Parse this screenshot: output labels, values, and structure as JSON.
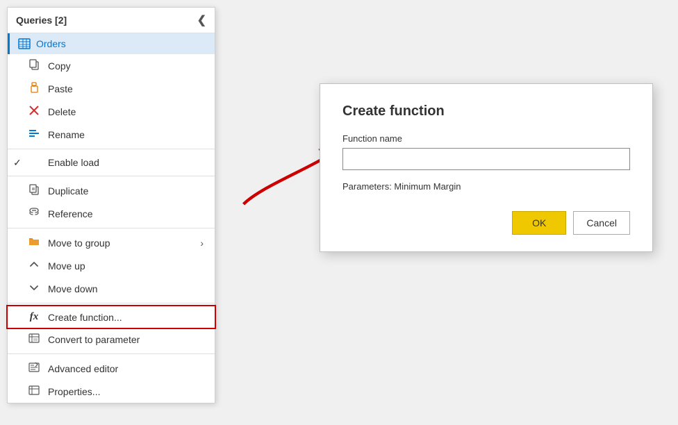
{
  "panel": {
    "title": "Queries [2]",
    "collapse_icon": "❮",
    "selected_query": "Orders"
  },
  "menu_items": [
    {
      "id": "copy",
      "label": "Copy",
      "icon": "copy",
      "indent": true
    },
    {
      "id": "paste",
      "label": "Paste",
      "icon": "paste",
      "indent": true
    },
    {
      "id": "delete",
      "label": "Delete",
      "icon": "delete",
      "indent": true
    },
    {
      "id": "rename",
      "label": "Rename",
      "icon": "rename",
      "indent": true
    },
    {
      "id": "divider1"
    },
    {
      "id": "enable-load",
      "label": "Enable load",
      "icon": "check",
      "indent": true,
      "checkmark": "✓"
    },
    {
      "id": "divider2"
    },
    {
      "id": "duplicate",
      "label": "Duplicate",
      "icon": "duplicate",
      "indent": true
    },
    {
      "id": "reference",
      "label": "Reference",
      "icon": "reference",
      "indent": true
    },
    {
      "id": "divider3"
    },
    {
      "id": "move-to-group",
      "label": "Move to group",
      "icon": "folder",
      "indent": true,
      "arrow": "›"
    },
    {
      "id": "move-up",
      "label": "Move up",
      "icon": "move-up",
      "indent": true
    },
    {
      "id": "move-down",
      "label": "Move down",
      "icon": "move-down",
      "indent": true
    },
    {
      "id": "divider4"
    },
    {
      "id": "create-function",
      "label": "Create function...",
      "icon": "fx",
      "indent": true,
      "highlighted": true
    },
    {
      "id": "convert-param",
      "label": "Convert to parameter",
      "icon": "convert",
      "indent": true
    },
    {
      "id": "divider5"
    },
    {
      "id": "adv-editor",
      "label": "Advanced editor",
      "icon": "adv-editor",
      "indent": true
    },
    {
      "id": "properties",
      "label": "Properties...",
      "icon": "properties",
      "indent": true
    }
  ],
  "dialog": {
    "title": "Create function",
    "function_name_label": "Function name",
    "function_name_placeholder": "",
    "params_label": "Parameters: Minimum Margin",
    "ok_label": "OK",
    "cancel_label": "Cancel"
  }
}
